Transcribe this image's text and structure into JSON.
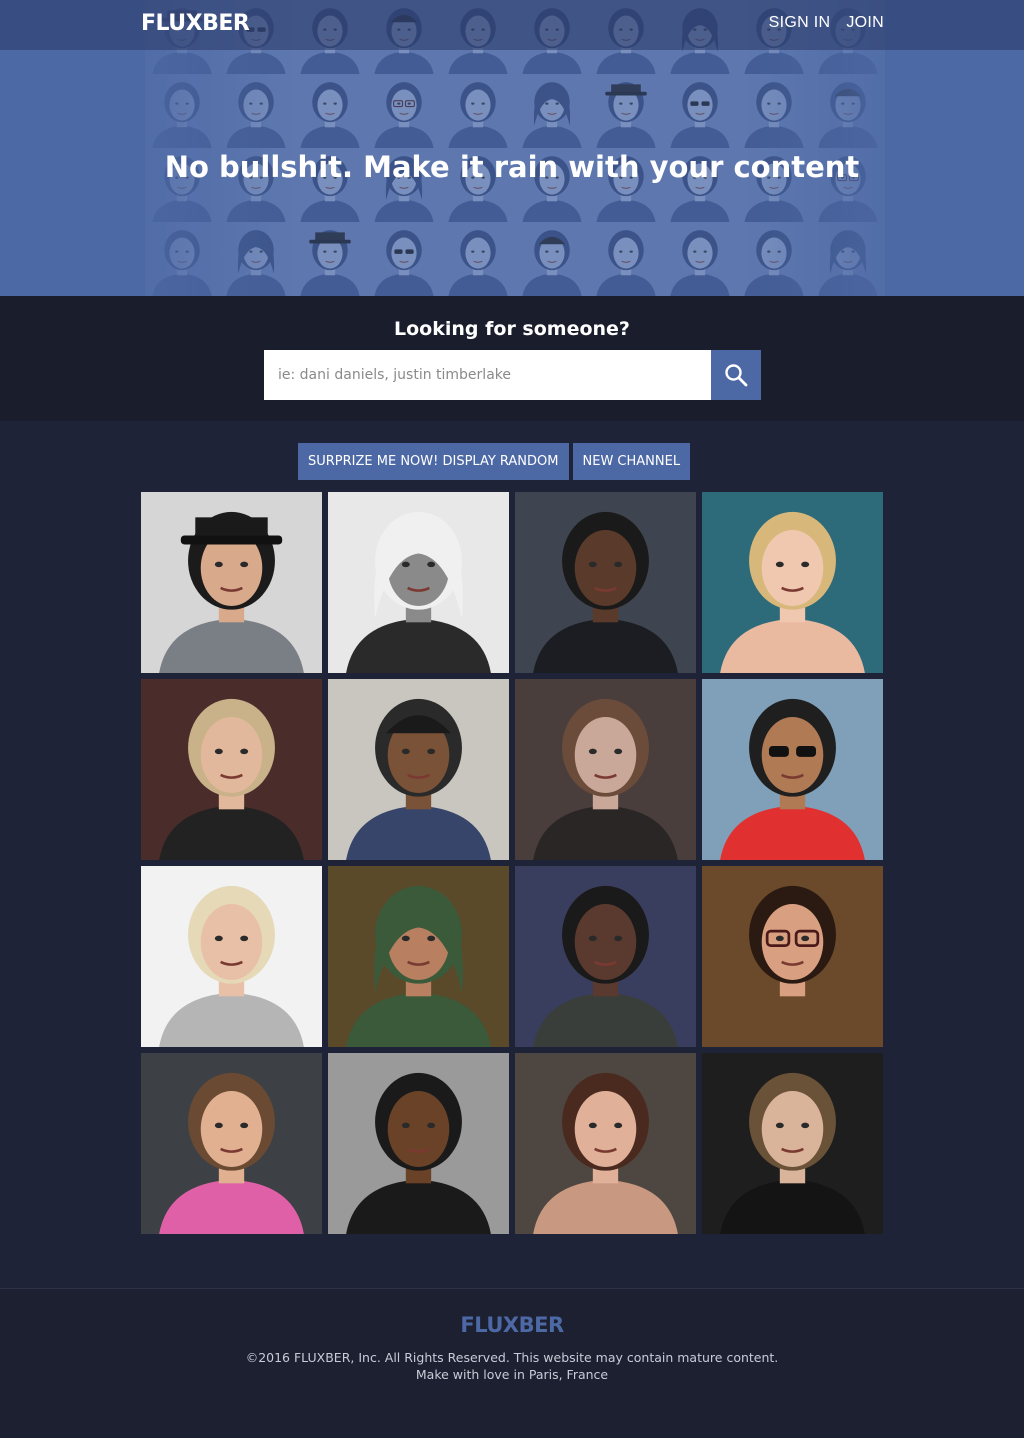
{
  "header": {
    "logo": "FLUXBER",
    "nav": {
      "sign_in": "SIGN IN",
      "join": "JOIN"
    }
  },
  "hero": {
    "tagline": "No bullshit. Make it rain with your content"
  },
  "search": {
    "title": "Looking for someone?",
    "placeholder": "ie: dani daniels, justin timberlake"
  },
  "actions": {
    "random_label": "SURPRIZE ME NOW! DISPLAY RANDOM",
    "new_channel_label": "NEW CHANNEL"
  },
  "profiles": [
    {
      "bg": "#d6d6d6",
      "skin": "#d9a98b",
      "hair": "#1b1b1b",
      "shirt": "#7a7f86",
      "icon": "man-with-hat"
    },
    {
      "bg": "#e8e8e8",
      "skin": "#8a8a8a",
      "hair": "#f0f0f0",
      "shirt": "#2a2a2a",
      "icon": "woman-hood"
    },
    {
      "bg": "#3f4550",
      "skin": "#5a3a2a",
      "hair": "#1a1a1a",
      "shirt": "#1b1d22",
      "icon": "man-suit"
    },
    {
      "bg": "#2d6a7a",
      "skin": "#f0c8b0",
      "hair": "#d8b87a",
      "shirt": "#e9b9a0",
      "icon": "woman-blonde"
    },
    {
      "bg": "#4a2d2a",
      "skin": "#e2b89c",
      "hair": "#c9b28a",
      "shirt": "#222",
      "icon": "woman-jacket"
    },
    {
      "bg": "#c9c6c0",
      "skin": "#7a5238",
      "hair": "#2a2a2a",
      "shirt": "#38456a",
      "icon": "man-cap"
    },
    {
      "bg": "#4a3e3c",
      "skin": "#c9a89a",
      "hair": "#6b4c3a",
      "shirt": "#2a2626",
      "icon": "woman-bangs"
    },
    {
      "bg": "#7fa0b8",
      "skin": "#b07a55",
      "hair": "#1f1f1f",
      "shirt": "#e03030",
      "icon": "man-sunglasses"
    },
    {
      "bg": "#f2f2f2",
      "skin": "#e8c0a8",
      "hair": "#e5d9b8",
      "shirt": "#b5b5b5",
      "icon": "man-blond"
    },
    {
      "bg": "#5a4a2a",
      "skin": "#b88060",
      "hair": "#3a5a3a",
      "shirt": "#3a5a3a",
      "icon": "woman-hijab"
    },
    {
      "bg": "#3a3e5e",
      "skin": "#5a3a2e",
      "hair": "#1a1a1a",
      "shirt": "#3a3e3a",
      "icon": "man-jacket"
    },
    {
      "bg": "#6a4a2a",
      "skin": "#d8a080",
      "hair": "#2a1a12",
      "shirt": "#6a4a2a",
      "icon": "woman-glasses"
    },
    {
      "bg": "#3d4044",
      "skin": "#e0b090",
      "hair": "#6a4a32",
      "shirt": "#e060a8",
      "icon": "woman-pink"
    },
    {
      "bg": "#9a9a9a",
      "skin": "#6a4228",
      "hair": "#1a1a1a",
      "shirt": "#1a1a1a",
      "icon": "man-smiling"
    },
    {
      "bg": "#4e4640",
      "skin": "#e0b098",
      "hair": "#4a2a1e",
      "shirt": "#c89880",
      "icon": "woman-brunette"
    },
    {
      "bg": "#1e1e1e",
      "skin": "#d9b49a",
      "hair": "#6a5238",
      "shirt": "#141414",
      "icon": "man-stubble"
    }
  ],
  "footer": {
    "logo": "FLUXBER",
    "line1": "©2016 FLUXBER, Inc. All Rights Reserved. This website may contain mature content.",
    "line2": "Make with love in Paris, France"
  }
}
